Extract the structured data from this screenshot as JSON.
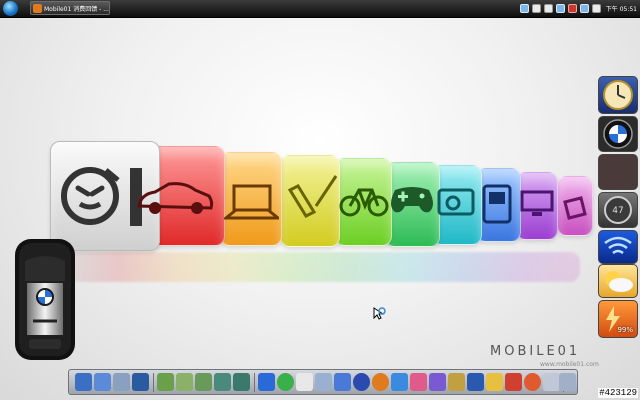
{
  "taskbar": {
    "task_label": "Mobile01 消费回馈 - ...",
    "clock": "下午 05:51"
  },
  "gadgets": {
    "battery_percent": "99%",
    "speedometer_value": "47"
  },
  "brand": {
    "logo_text": "MOBILE01",
    "site": "www.mobile01.com"
  },
  "counter": "#423129"
}
